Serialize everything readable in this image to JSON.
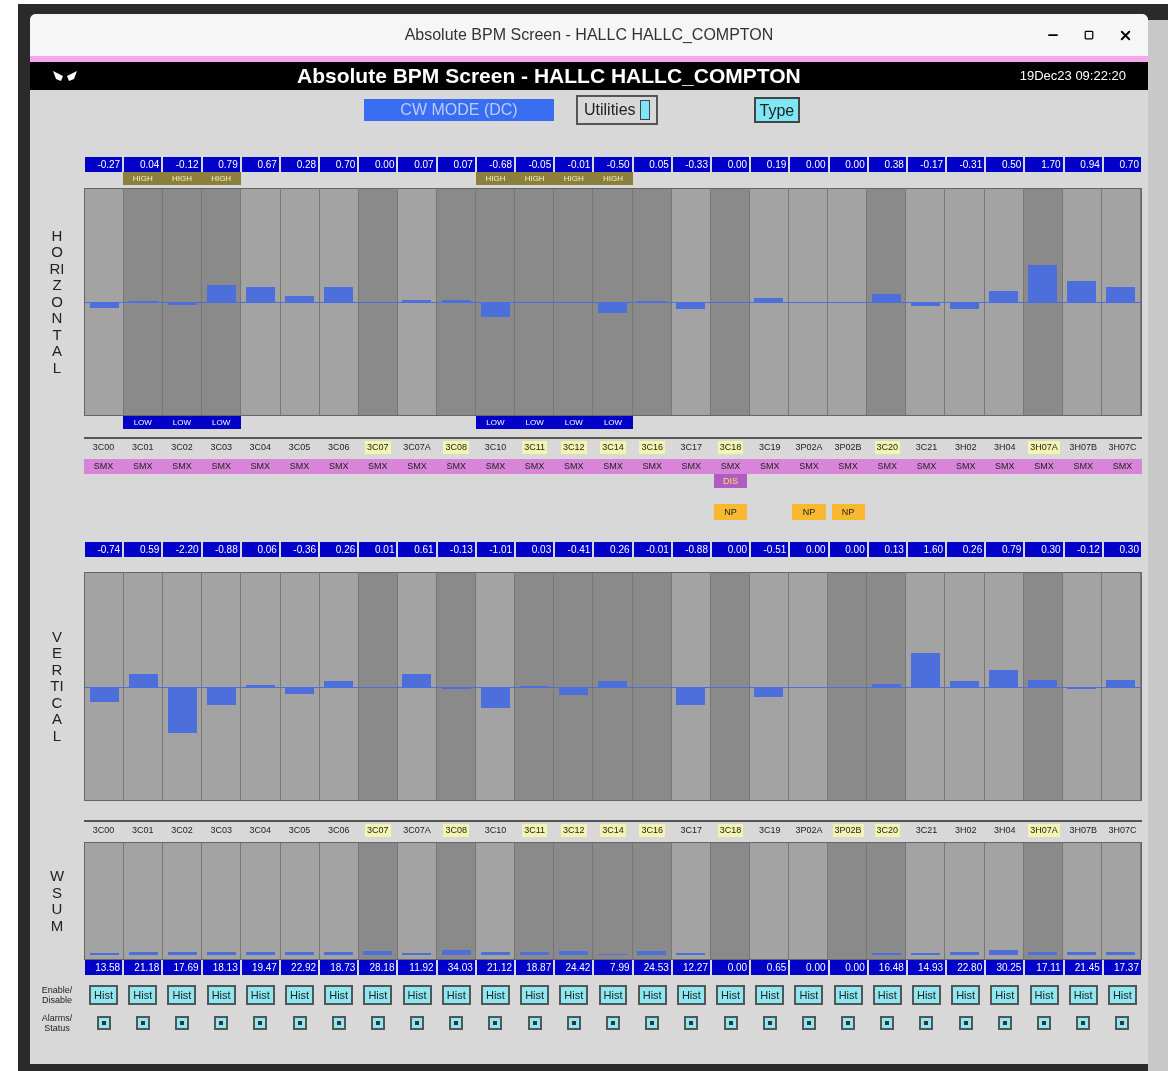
{
  "window": {
    "title": "Absolute BPM Screen - HALLC HALLC_COMPTON"
  },
  "header": {
    "title": "Absolute BPM Screen - HALLC HALLC_COMPTON",
    "timestamp": "19Dec23 09:22:20"
  },
  "mode": "CW MODE (DC)",
  "buttons": [
    {
      "label": "Utilities",
      "kind": "menu"
    },
    {
      "label": "Type",
      "kind": "toggle"
    }
  ],
  "plane_labels": {
    "horizontal": "HORIZONTAL",
    "vertical": "VERTICAL",
    "wsum": "WSUM"
  },
  "row_labels": {
    "enable": "Enable/ Disable",
    "alarms": "Alarms/ Status"
  },
  "channels": [
    {
      "name": "3C00",
      "v_name": "3C00",
      "h": "-0.27",
      "v": "-0.74",
      "wsum": "13.58",
      "h_marked": false,
      "v_marked": false,
      "status": "SMX",
      "hist": "Hist"
    },
    {
      "name": "3C01",
      "v_name": "3C01",
      "h": "0.04",
      "v": "0.59",
      "wsum": "21.18",
      "high": "HIGH",
      "low": "LOW",
      "h_marked": false,
      "v_marked": false,
      "status": "SMX",
      "hist": "Hist"
    },
    {
      "name": "3C02",
      "v_name": "3C02",
      "h": "-0.12",
      "v": "-2.20",
      "wsum": "17.69",
      "high": "HIGH",
      "low": "LOW",
      "h_marked": false,
      "v_marked": false,
      "status": "SMX",
      "hist": "Hist"
    },
    {
      "name": "3C03",
      "v_name": "3C03",
      "h": "0.79",
      "v": "-0.88",
      "wsum": "18.13",
      "high": "HIGH",
      "low": "LOW",
      "h_marked": false,
      "v_marked": false,
      "status": "SMX",
      "hist": "Hist"
    },
    {
      "name": "3C04",
      "v_name": "3C04",
      "h": "0.67",
      "v": "0.06",
      "wsum": "19.47",
      "h_marked": false,
      "v_marked": false,
      "status": "SMX",
      "hist": "Hist"
    },
    {
      "name": "3C05",
      "v_name": "3C05",
      "h": "0.28",
      "v": "-0.36",
      "wsum": "22.92",
      "h_marked": false,
      "v_marked": false,
      "status": "SMX",
      "hist": "Hist"
    },
    {
      "name": "3C06",
      "v_name": "3C06",
      "h": "0.70",
      "v": "0.26",
      "wsum": "18.73",
      "h_marked": false,
      "v_marked": false,
      "status": "SMX",
      "hist": "Hist"
    },
    {
      "name": "3C07",
      "v_name": "3C07",
      "h": "0.00",
      "v": "0.01",
      "wsum": "28.18",
      "h_marked": true,
      "v_marked": true,
      "status": "SMX",
      "hist": "Hist"
    },
    {
      "name": "3C07A",
      "v_name": "3C07A",
      "h": "0.07",
      "v": "0.61",
      "wsum": "11.92",
      "h_marked": false,
      "v_marked": false,
      "status": "SMX",
      "hist": "Hist"
    },
    {
      "name": "3C08",
      "v_name": "3C08",
      "h": "0.07",
      "v": "-0.13",
      "wsum": "34.03",
      "h_marked": true,
      "v_marked": true,
      "status": "SMX",
      "hist": "Hist"
    },
    {
      "name": "3C10",
      "v_name": "3C10",
      "h": "-0.68",
      "v": "-1.01",
      "wsum": "21.12",
      "high": "HIGH",
      "low": "LOW",
      "h_marked": false,
      "v_marked": false,
      "status": "SMX",
      "hist": "Hist"
    },
    {
      "name": "3C11",
      "v_name": "3C11",
      "h": "-0.05",
      "v": "0.03",
      "wsum": "18.87",
      "high": "HIGH",
      "low": "LOW",
      "h_marked": true,
      "v_marked": true,
      "status": "SMX",
      "hist": "Hist"
    },
    {
      "name": "3C12",
      "v_name": "3C12",
      "h": "-0.01",
      "v": "-0.41",
      "wsum": "24.42",
      "high": "HIGH",
      "low": "LOW",
      "h_marked": true,
      "v_marked": true,
      "status": "SMX",
      "hist": "Hist"
    },
    {
      "name": "3C14",
      "v_name": "3C14",
      "h": "-0.50",
      "v": "0.26",
      "wsum": "7.99",
      "high": "HIGH",
      "low": "LOW",
      "h_marked": true,
      "v_marked": true,
      "status": "SMX",
      "hist": "Hist"
    },
    {
      "name": "3C16",
      "v_name": "3C16",
      "h": "0.05",
      "v": "-0.01",
      "wsum": "24.53",
      "h_marked": true,
      "v_marked": true,
      "status": "SMX",
      "hist": "Hist"
    },
    {
      "name": "3C17",
      "v_name": "3C17",
      "h": "-0.33",
      "v": "-0.88",
      "wsum": "12.27",
      "h_marked": false,
      "v_marked": false,
      "status": "SMX",
      "hist": "Hist"
    },
    {
      "name": "3C18",
      "v_name": "3C18",
      "h": "0.00",
      "v": "0.00",
      "wsum": "0.00",
      "h_marked": true,
      "v_marked": true,
      "status": "SMX",
      "dis": "DIS",
      "np": "NP",
      "hist": "Hist"
    },
    {
      "name": "3C19",
      "v_name": "3C19",
      "h": "0.19",
      "v": "-0.51",
      "wsum": "0.65",
      "h_marked": false,
      "v_marked": false,
      "status": "SMX",
      "hist": "Hist"
    },
    {
      "name": "3P02A",
      "v_name": "3P02A",
      "h": "0.00",
      "v": "0.00",
      "wsum": "0.00",
      "h_marked": false,
      "v_marked": false,
      "status": "SMX",
      "np": "NP",
      "hist": "Hist"
    },
    {
      "name": "3P02B",
      "v_name": "3P02B",
      "h": "0.00",
      "v": "0.00",
      "wsum": "0.00",
      "h_marked": false,
      "v_marked": true,
      "status": "SMX",
      "np": "NP",
      "hist": "Hist"
    },
    {
      "name": "3C20",
      "v_name": "3C20",
      "h": "0.38",
      "v": "0.13",
      "wsum": "16.48",
      "h_marked": true,
      "v_marked": true,
      "status": "SMX",
      "hist": "Hist"
    },
    {
      "name": "3C21",
      "v_name": "3C21",
      "h": "-0.17",
      "v": "1.60",
      "wsum": "14.93",
      "h_marked": false,
      "v_marked": false,
      "status": "SMX",
      "hist": "Hist"
    },
    {
      "name": "3H02",
      "v_name": "3H02",
      "h": "-0.31",
      "v": "0.26",
      "wsum": "22.80",
      "h_marked": false,
      "v_marked": false,
      "status": "SMX",
      "hist": "Hist"
    },
    {
      "name": "3H04",
      "v_name": "3H04",
      "h": "0.50",
      "v": "0.79",
      "wsum": "30.25",
      "h_marked": false,
      "v_marked": false,
      "status": "SMX",
      "hist": "Hist"
    },
    {
      "name": "3H07A",
      "v_name": "3H07A",
      "h": "1.70",
      "v": "0.30",
      "wsum": "17.11",
      "h_marked": true,
      "v_marked": true,
      "status": "SMX",
      "hist": "Hist"
    },
    {
      "name": "3H07B",
      "v_name": "3H07B",
      "h": "0.94",
      "v": "-0.12",
      "wsum": "21.45",
      "h_marked": false,
      "v_marked": false,
      "status": "SMX",
      "hist": "Hist"
    },
    {
      "name": "3H07C",
      "v_name": "3H07C",
      "h": "0.70",
      "v": "0.30",
      "wsum": "17.37",
      "h_marked": false,
      "v_marked": false,
      "status": "SMX",
      "hist": "Hist"
    }
  ]
}
